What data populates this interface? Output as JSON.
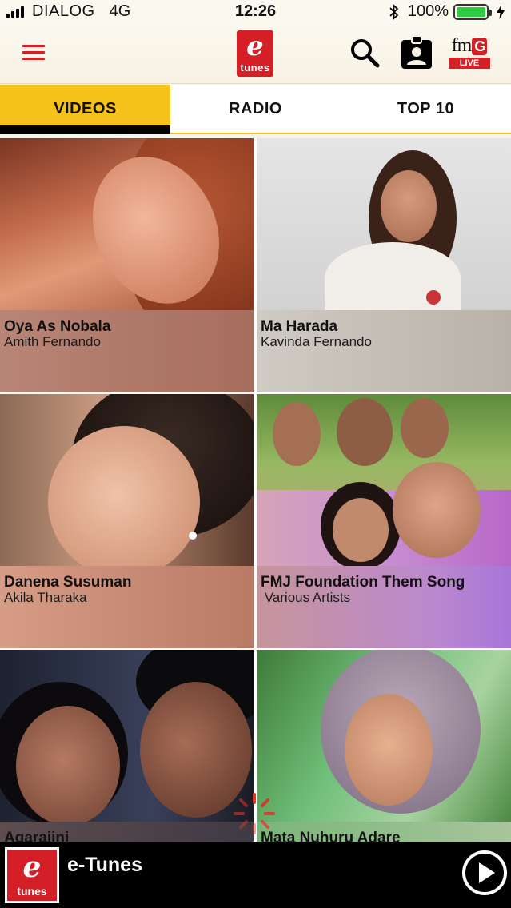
{
  "status_bar": {
    "carrier": "DIALOG",
    "network": "4G",
    "time": "12:26",
    "battery": "100%",
    "battery_level": 1.0
  },
  "header": {
    "logo_letter": "e",
    "logo_text": "tunes",
    "fm_text": "fm",
    "fm_badge": "G",
    "live_label": "LIVE"
  },
  "tabs": [
    {
      "label": "VIDEOS",
      "active": true
    },
    {
      "label": "RADIO",
      "active": false
    },
    {
      "label": "TOP 10",
      "active": false
    }
  ],
  "videos": [
    {
      "title": "Oya As Nobala",
      "artist": "Amith Fernando"
    },
    {
      "title": "Ma Harada",
      "artist": "Kavinda Fernando"
    },
    {
      "title": "Danena Susuman",
      "artist": "Akila Tharaka"
    },
    {
      "title": "FMJ Foundation Them Song",
      "artist": " Various Artists"
    },
    {
      "title": "Agaraiini",
      "artist": ""
    },
    {
      "title": "Mata Nuhuru Adare",
      "artist": ""
    }
  ],
  "player": {
    "logo_letter": "e",
    "logo_text": "tunes",
    "title": "e-Tunes"
  },
  "colors": {
    "accent_red": "#d51f26",
    "tab_active": "#f4c21a",
    "player_bg": "#000000"
  }
}
